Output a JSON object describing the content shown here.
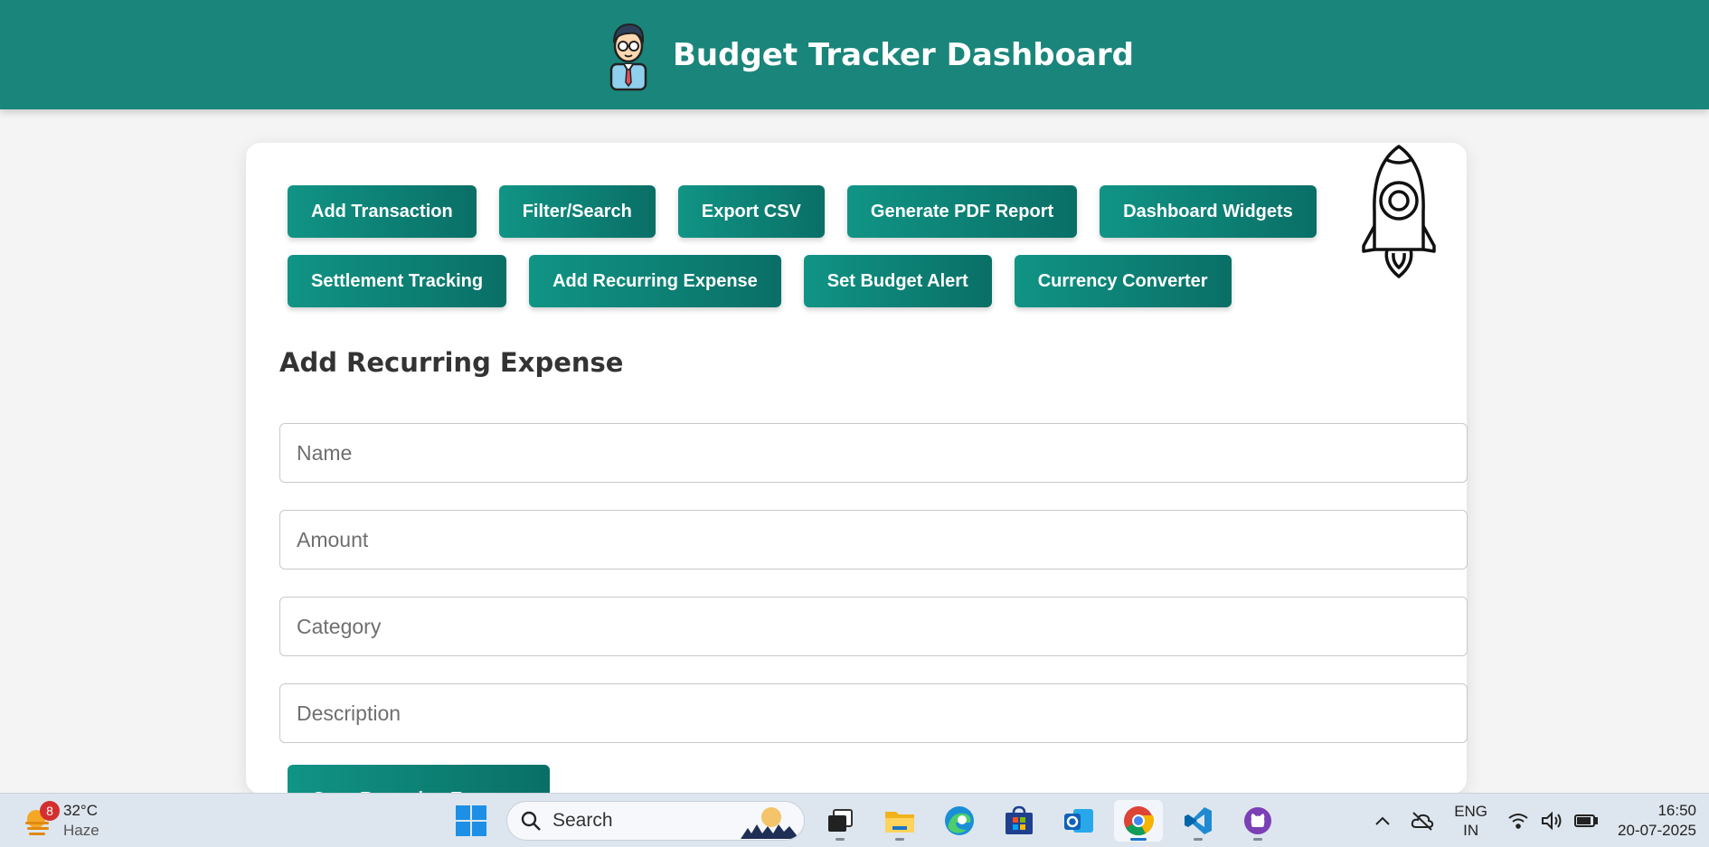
{
  "header": {
    "title": "Budget Tracker Dashboard",
    "avatar_icon": "user-avatar-icon"
  },
  "toolbar": {
    "row1": [
      "Add Transaction",
      "Filter/Search",
      "Export CSV",
      "Generate PDF Report",
      "Dashboard Widgets"
    ],
    "row2": [
      "Settlement Tracking",
      "Add Recurring Expense",
      "Set Budget Alert",
      "Currency Converter"
    ],
    "decoration_icon": "rocket-icon"
  },
  "form": {
    "title": "Add Recurring Expense",
    "name_placeholder": "Name",
    "amount_placeholder": "Amount",
    "category_placeholder": "Category",
    "description_placeholder": "Description",
    "save_label": "Save Recurring Expense"
  },
  "taskbar": {
    "weather": {
      "temp": "32°C",
      "condition": "Haze",
      "badge": "8"
    },
    "search_label": "Search",
    "apps": [
      "task-view-icon",
      "file-explorer-icon",
      "edge-icon",
      "store-icon",
      "outlook-icon",
      "chrome-icon",
      "vscode-icon",
      "github-icon"
    ],
    "active_app": "chrome-icon",
    "lang_top": "ENG",
    "lang_bottom": "IN",
    "time": "16:50",
    "date": "20-07-2025"
  },
  "colors": {
    "header": "#1a857a",
    "button": "#0f8a7e",
    "background": "#f4f4f4"
  }
}
